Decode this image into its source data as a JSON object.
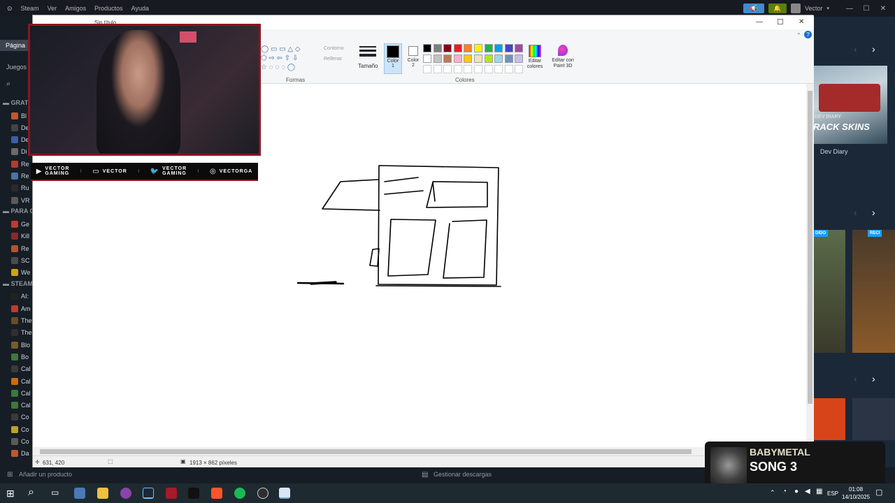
{
  "steam": {
    "menu": [
      "Steam",
      "Ver",
      "Amigos",
      "Productos",
      "Ayuda"
    ],
    "user": "Vector",
    "controls": {
      "minimize": "—",
      "maximize": "☐",
      "close": "✕"
    }
  },
  "sidebar": {
    "tab_home": "Página",
    "tab_games": "Juegos",
    "sections": [
      {
        "label": "GRAT",
        "items": [
          "Bl",
          "De",
          "De",
          "Di",
          "Re",
          "Re",
          "Ru",
          "VR"
        ]
      },
      {
        "label": "PARA G",
        "items": [
          "Ge",
          "Kill",
          "Re",
          "SC",
          "We"
        ]
      },
      {
        "label": "STEAM",
        "items": [
          "AI:",
          "Am",
          "The",
          "The",
          "Blo",
          "Bo",
          "Cal",
          "Cal",
          "Cal",
          "Cal",
          "Co",
          "Co",
          "Co",
          "Da"
        ]
      }
    ]
  },
  "paint": {
    "doc_title": "Sin título",
    "controls": {
      "minimize": "—",
      "maximize": "☐",
      "close": "✕"
    },
    "ribbon": {
      "shapes_group": "Formas",
      "outline_label": "Contorno",
      "fill_label": "Rellenar",
      "size_label": "Tamaño",
      "color1_label": "Color",
      "color1_sub": "1",
      "color2_label": "Color",
      "color2_sub": "2",
      "colors_group": "Colores",
      "edit_colors": "Editar colores",
      "edit_paint3d": "Editar con Paint 3D",
      "palette_row1": [
        "#000000",
        "#7f7f7f",
        "#880015",
        "#ed1c24",
        "#ff7f27",
        "#fff200",
        "#22b14c",
        "#00a2e8",
        "#3f48cc",
        "#a349a4"
      ],
      "palette_row2": [
        "#ffffff",
        "#c3c3c3",
        "#b97a57",
        "#ffaec9",
        "#ffc90e",
        "#efe4b0",
        "#b5e61d",
        "#99d9ea",
        "#7092be",
        "#c8bfe7"
      ]
    },
    "status": {
      "cursor_pos": "631, 420",
      "canvas_size": "1913 × 862 píxeles"
    }
  },
  "overlay": {
    "social": [
      {
        "icon": "youtube-icon",
        "label": "VECTOR\nGAMING"
      },
      {
        "icon": "chat-icon",
        "label": "VECTOR"
      },
      {
        "icon": "twitter-icon",
        "label": "VECTOR\nGAMING"
      },
      {
        "icon": "instagram-icon",
        "label": "VECTORGA"
      }
    ],
    "separator": "I"
  },
  "store": {
    "dev_diary_banner": "RACK SKINS",
    "dev_diary_tag": "DEV DIARY",
    "dev_diary_label": "Dev Diary",
    "badge_left": "DIDO",
    "badge_right": "RECI"
  },
  "steam_bottom": {
    "add_product": "Añadir un producto",
    "downloads": "Gestionar descargas"
  },
  "now_playing": {
    "artist": "BABYMETAL",
    "song": "SONG 3"
  },
  "taskbar": {
    "lang": "ESP",
    "time": "01:08",
    "date": "14/10/2025"
  }
}
